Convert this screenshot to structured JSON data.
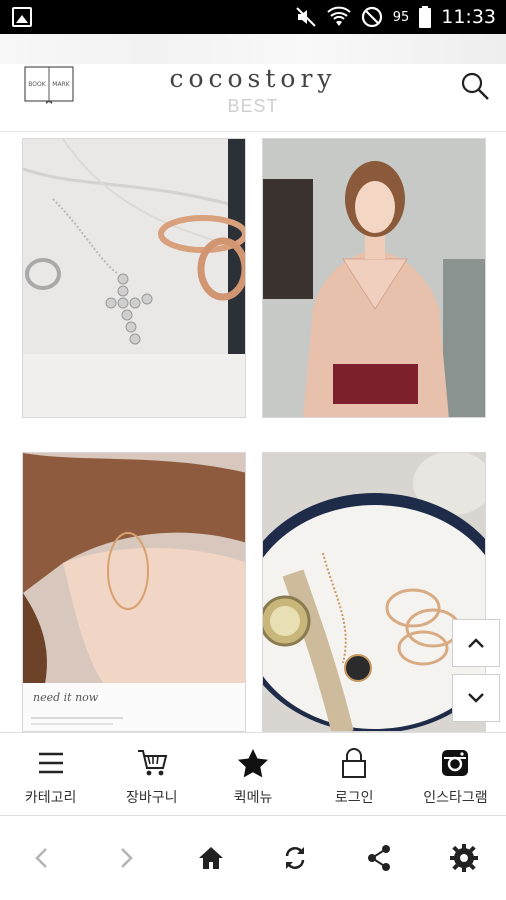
{
  "status_bar": {
    "battery_percent": "95",
    "time": "11:33"
  },
  "header": {
    "brand": "cocostory",
    "section": "BEST",
    "logo_text": "BOOK MARK"
  },
  "tabs": [
    {
      "label": "카테고리",
      "icon": "menu-icon"
    },
    {
      "label": "장바구니",
      "icon": "cart-icon"
    },
    {
      "label": "퀵메뉴",
      "icon": "star-icon"
    },
    {
      "label": "로그인",
      "icon": "lock-icon"
    },
    {
      "label": "인스타그램",
      "icon": "instagram-icon"
    }
  ],
  "products_caption": "need it now"
}
